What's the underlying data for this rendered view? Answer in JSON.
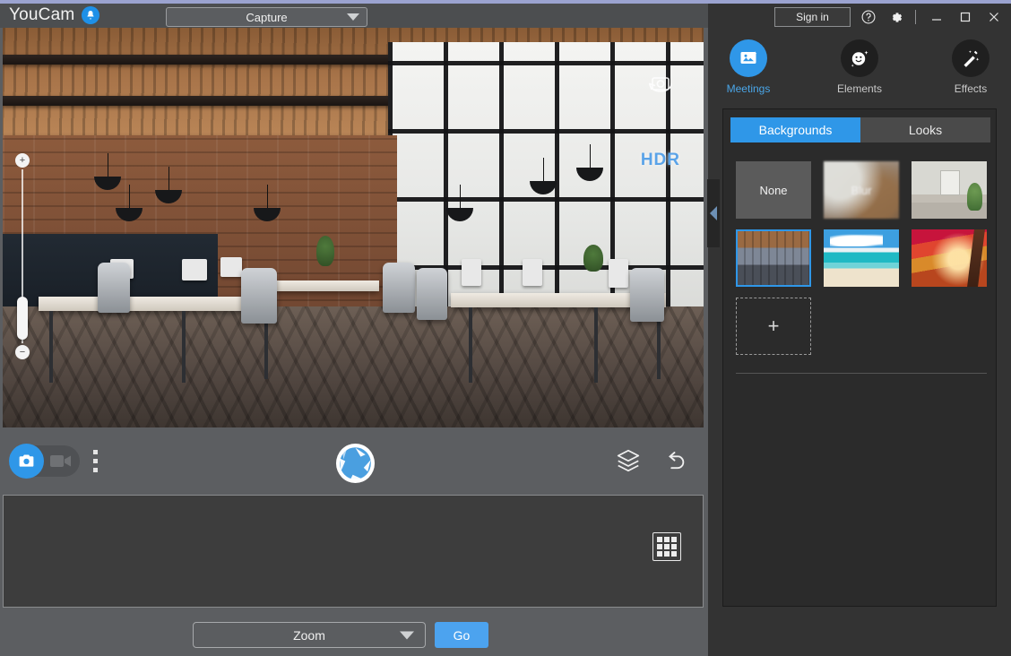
{
  "app": {
    "brand": "YouCam",
    "notification_icon": "bell-icon"
  },
  "titlebar": {
    "capture_mode": "Capture",
    "capture_caret_icon": "chevron-down-icon"
  },
  "preview": {
    "zoom_in_label": "+",
    "zoom_out_label": "−",
    "hdr_label": "HDR",
    "rotate_camera_icon": "rotate-camera-icon",
    "collapse_icon": "chevron-left-icon"
  },
  "toolbar": {
    "photo_mode_icon": "camera-icon",
    "video_mode_icon": "video-camera-icon",
    "more_options_icon": "kebab-menu-icon",
    "shutter_icon": "shutter-aperture-icon",
    "layers_icon": "layers-icon",
    "undo_icon": "undo-icon"
  },
  "media_tray": {
    "grid_view_icon": "grid-view-icon"
  },
  "bottom_bar": {
    "target_app": "Zoom",
    "target_caret_icon": "chevron-down-icon",
    "go_label": "Go"
  },
  "right_panel": {
    "sign_in_label": "Sign in",
    "help_icon": "help-circle-icon",
    "settings_icon": "gear-icon",
    "minimize_icon": "minimize-icon",
    "maximize_icon": "maximize-icon",
    "close_icon": "close-icon",
    "modes": [
      {
        "label": "Meetings",
        "icon": "meetings-icon",
        "active": true
      },
      {
        "label": "Elements",
        "icon": "elements-smiley-icon",
        "active": false
      },
      {
        "label": "Effects",
        "icon": "effects-wand-icon",
        "active": false
      }
    ],
    "tabs": [
      {
        "label": "Backgrounds",
        "active": true
      },
      {
        "label": "Looks",
        "active": false
      }
    ],
    "backgrounds": [
      {
        "label": "None",
        "kind": "none",
        "selected": false
      },
      {
        "label": "Blur",
        "kind": "blur",
        "selected": false
      },
      {
        "label": "",
        "kind": "room",
        "selected": false
      },
      {
        "label": "",
        "kind": "loft",
        "selected": true
      },
      {
        "label": "",
        "kind": "beach",
        "selected": false
      },
      {
        "label": "",
        "kind": "autumn",
        "selected": false
      }
    ],
    "add_background_label": "+"
  },
  "colors": {
    "accent": "#2f97e8",
    "panel_dark": "#2b2b2b",
    "panel_mid": "#333333",
    "toolbar_gray": "#5c5e61",
    "top_strip": "#9ba3d0"
  }
}
